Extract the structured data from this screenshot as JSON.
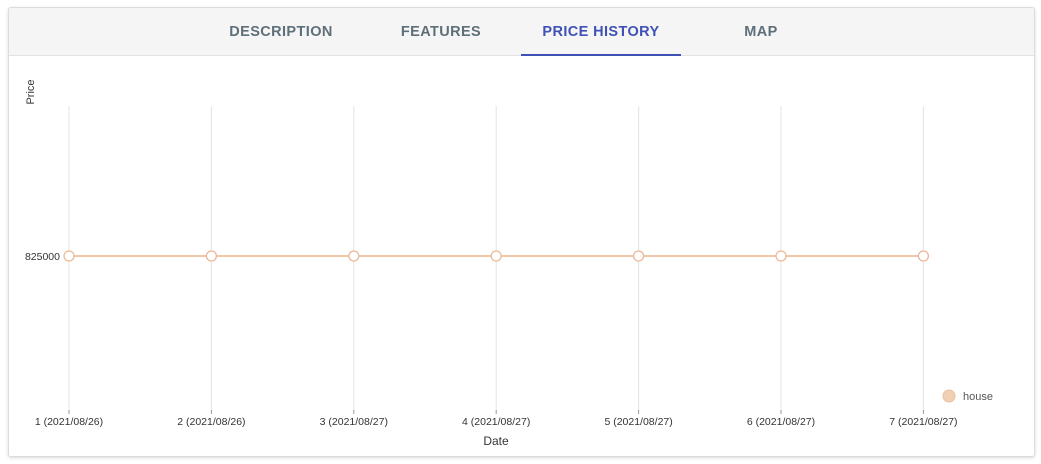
{
  "tabs": [
    {
      "label": "DESCRIPTION",
      "active": false
    },
    {
      "label": "FEATURES",
      "active": false
    },
    {
      "label": "PRICE HISTORY",
      "active": true
    },
    {
      "label": "MAP",
      "active": false
    }
  ],
  "colors": {
    "accent": "#3f51b5",
    "series": "#f0c8a8",
    "grid": "#e4e4e4"
  },
  "chart_data": {
    "type": "line",
    "xlabel": "Date",
    "ylabel": "Price",
    "categories": [
      "1 (2021/08/26)",
      "2 (2021/08/26)",
      "3 (2021/08/27)",
      "4 (2021/08/27)",
      "5 (2021/08/27)",
      "6 (2021/08/27)",
      "7 (2021/08/27)"
    ],
    "y_ticks": [
      "825000"
    ],
    "series": [
      {
        "name": "house",
        "values": [
          825000,
          825000,
          825000,
          825000,
          825000,
          825000,
          825000
        ]
      }
    ],
    "legend_position": "bottom-right",
    "grid": "vertical"
  }
}
